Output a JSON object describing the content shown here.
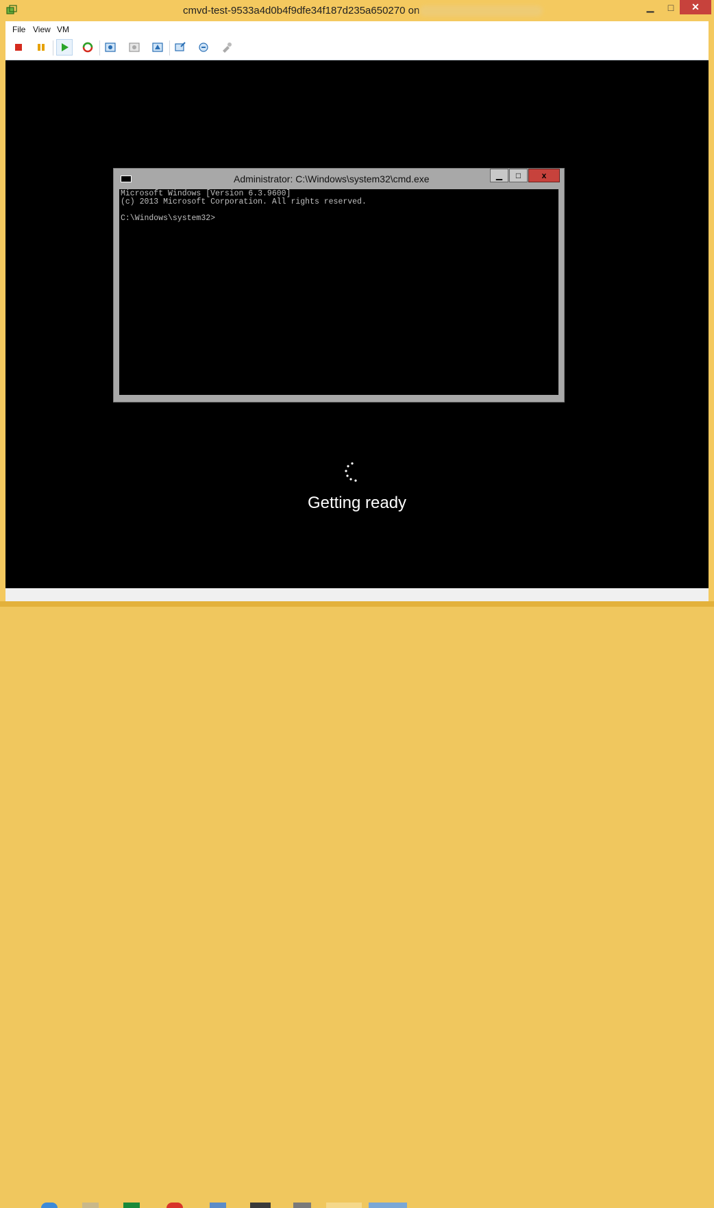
{
  "window": {
    "title": "cmvd-test-9533a4d0b4f9dfe34f187d235a650270 on",
    "min_icon": "minimize-icon",
    "max_icon": "maximize-icon",
    "close_icon": "close-icon"
  },
  "menubar": {
    "items": [
      "File",
      "View",
      "VM"
    ]
  },
  "toolbar": {
    "icons": [
      "stop-icon",
      "pause-icon",
      "start-icon",
      "reset-icon",
      "snapshot-icon",
      "revert-icon",
      "manage-snapshots-icon",
      "vm-settings-icon",
      "send-ctrl-alt-del-icon",
      "install-tools-icon"
    ]
  },
  "cmd": {
    "title": "Administrator: C:\\Windows\\system32\\cmd.exe",
    "lines": [
      "Microsoft Windows [Version 6.3.9600]",
      "(c) 2013 Microsoft Corporation. All rights reserved.",
      "",
      "C:\\Windows\\system32>"
    ],
    "min_label": "▁",
    "max_label": "□",
    "close_label": "x"
  },
  "status": {
    "text": "Getting ready"
  },
  "colors": {
    "title_bg": "#f4c95f",
    "close_red": "#c7423c",
    "screen_bg": "#000000",
    "cmd_frame": "#a8a8a8"
  }
}
